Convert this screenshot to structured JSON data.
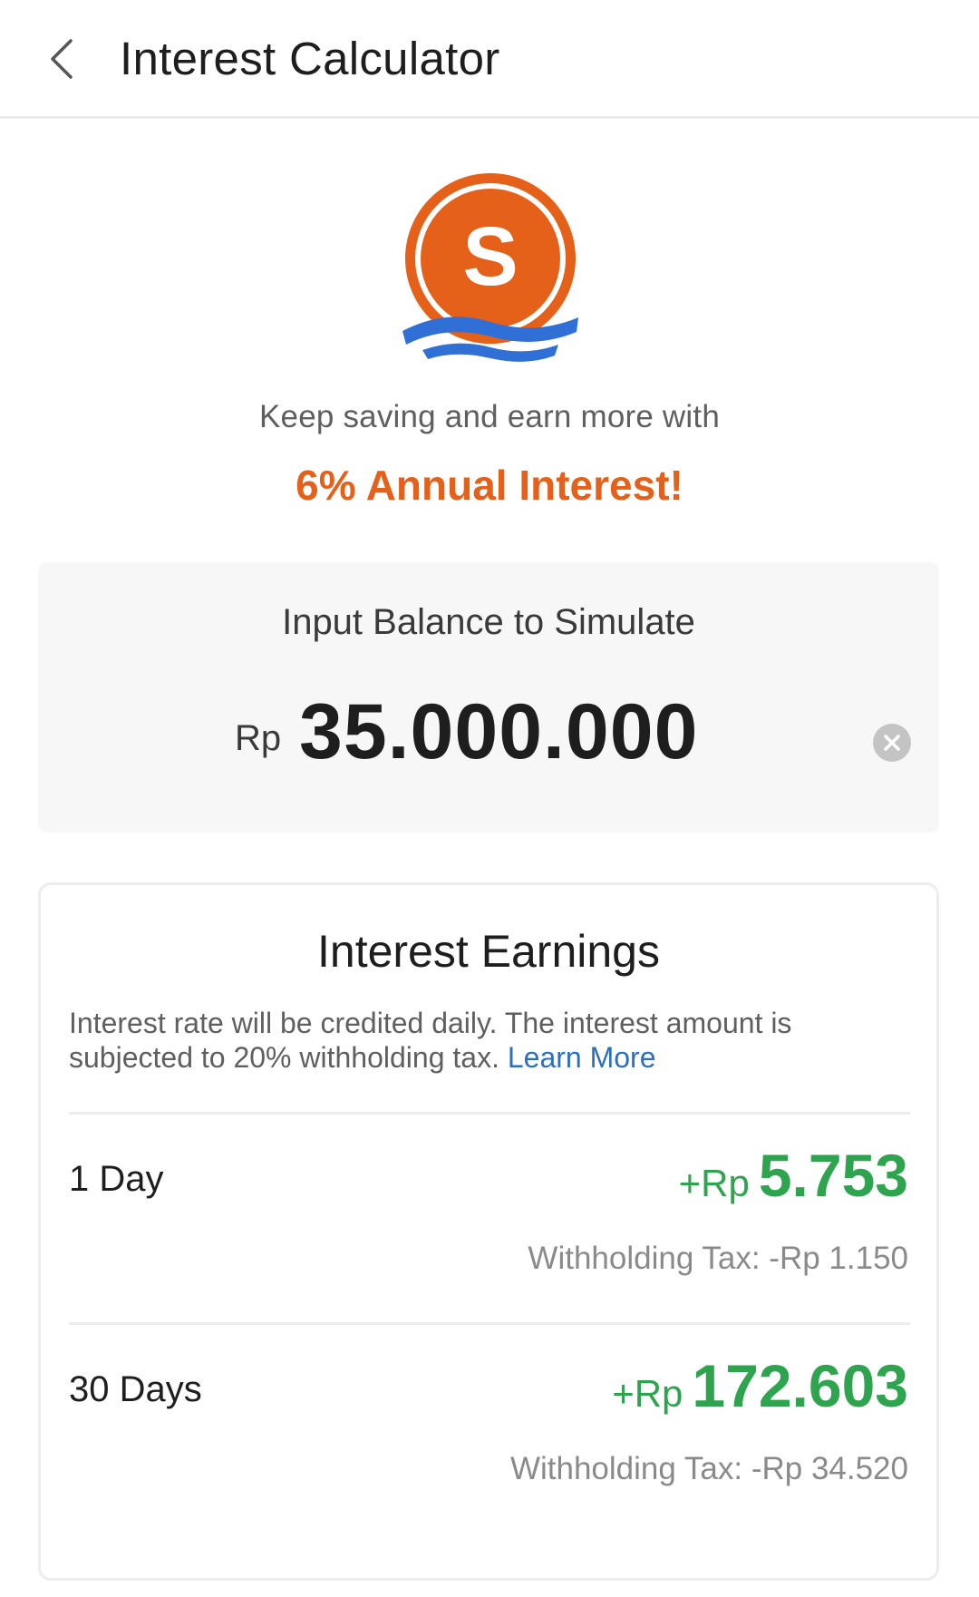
{
  "header": {
    "title": "Interest Calculator",
    "back_icon": "chevron-left-icon"
  },
  "promo": {
    "logo_letter": "S",
    "tagline": "Keep saving and earn more with",
    "headline": "6% Annual Interest!"
  },
  "balance": {
    "label": "Input Balance to Simulate",
    "currency": "Rp",
    "amount": "35.000.000",
    "clear_icon": "clear-circle-icon"
  },
  "earnings": {
    "title": "Interest Earnings",
    "description": "Interest rate will be credited daily. The interest amount is subjected to 20% withholding tax.",
    "learn_more": "Learn More",
    "rows": [
      {
        "period": "1 Day",
        "gain_prefix": "+Rp",
        "gain_value": "5.753",
        "tax": "Withholding Tax: -Rp 1.150"
      },
      {
        "period": "30 Days",
        "gain_prefix": "+Rp",
        "gain_value": "172.603",
        "tax": "Withholding Tax: -Rp 34.520"
      }
    ]
  },
  "colors": {
    "accent_orange": "#e5611a",
    "logo_wave_blue": "#2f6fd6",
    "gain_green": "#2ea44f",
    "link_blue": "#2a6fc0"
  }
}
